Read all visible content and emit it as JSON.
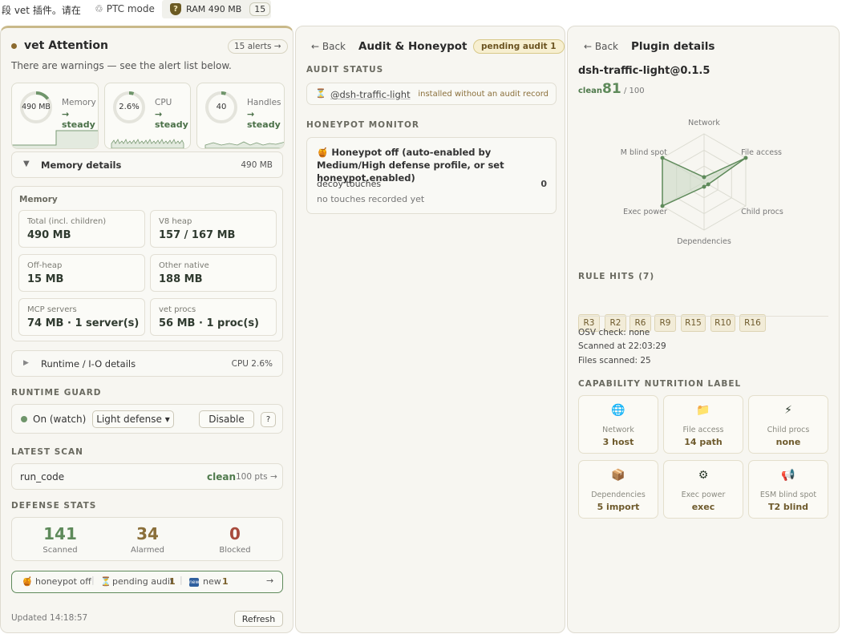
{
  "topbar": {
    "text": "段 vet 插件。请在",
    "ptc_icon": "recycle-icon",
    "ptc_label": "PTC mode",
    "ram_label": "RAM 490 MB",
    "ram_count": "15"
  },
  "left": {
    "title": "vet Attention",
    "alerts_pill": "15 alerts →",
    "warning": "There are warnings — see the alert list below.",
    "gauges": [
      {
        "value": "490 MB",
        "label": "Memory",
        "trend": "→ steady",
        "fraction": 0.15
      },
      {
        "value": "2.6%",
        "label": "CPU",
        "trend": "→ steady",
        "fraction": 0.05
      },
      {
        "value": "40",
        "label": "Handles",
        "trend": "→ steady",
        "fraction": 0.05
      }
    ],
    "memory_details": {
      "label": "Memory details",
      "value": "490 MB",
      "chevron": "▼"
    },
    "memory_section": "Memory",
    "memory_cells": [
      {
        "k": "Total (incl. children)",
        "v": "490 MB"
      },
      {
        "k": "V8 heap",
        "v": "157 / 167 MB"
      },
      {
        "k": "Off-heap",
        "v": "15 MB"
      },
      {
        "k": "Other native",
        "v": "188 MB"
      },
      {
        "k": "MCP servers",
        "v": "74 MB · 1 server(s)"
      },
      {
        "k": "vet procs",
        "v": "56 MB · 1 proc(s)"
      }
    ],
    "runtime_details": {
      "label": "Runtime / I-O details",
      "value": "CPU 2.6%",
      "chevron": "▶"
    },
    "runtime_guard_label": "RUNTIME GUARD",
    "guard_status": "On (watch)",
    "guard_mode": "Light defense ▾",
    "disable_label": "Disable",
    "help_label": "?",
    "latest_scan_label": "LATEST SCAN",
    "scan_name": "run_code",
    "scan_status": "clean",
    "scan_pts": "100 pts →",
    "defense_label": "DEFENSE STATS",
    "stats": [
      {
        "num": "141",
        "label": "Scanned",
        "color": "#5e8a5a"
      },
      {
        "num": "34",
        "label": "Alarmed",
        "color": "#8a6f3a"
      },
      {
        "num": "0",
        "label": "Blocked",
        "color": "#a84b3c"
      }
    ],
    "footer_strip": {
      "honeypot": "honeypot off",
      "pending": "pending audit",
      "pending_n": "1",
      "new": "new",
      "new_n": "1",
      "arrow": "→"
    },
    "updated": "Updated 14:18:57",
    "refresh_label": "Refresh"
  },
  "middle": {
    "back": "← Back",
    "title": "Audit & Honeypot",
    "pending_pill": "pending audit 1",
    "audit_status_label": "AUDIT STATUS",
    "audit_item": "@dsh-traffic-light",
    "audit_note": "installed without an audit record",
    "honeypot_label": "HONEYPOT MONITOR",
    "honeypot_title": "Honeypot off (auto-enabled by Medium/High defense profile, or set honeypot.enabled)",
    "decoy_label": "decoy touches",
    "decoy_value": "0",
    "no_touches": "no touches recorded yet"
  },
  "right": {
    "back": "← Back",
    "title": "Plugin details",
    "plugin_name": "dsh-traffic-light@0.1.5",
    "clean_label": "clean",
    "score": "81",
    "score_max": "/ 100",
    "radar_axes": [
      {
        "label": "Network",
        "value": 0.1
      },
      {
        "label": "File access",
        "value": 1.0
      },
      {
        "label": "Child procs",
        "value": 0.0
      },
      {
        "label": "Dependencies",
        "value": 0.1
      },
      {
        "label": "Exec power",
        "value": 1.0
      },
      {
        "label": "M blind spot",
        "value": 1.0
      }
    ],
    "rule_hits_label": "RULE HITS",
    "rule_hits_count": "(7)",
    "rules": [
      "R3",
      "R2",
      "R6",
      "R9",
      "R15",
      "R10",
      "R16"
    ],
    "osv": "OSV check: none",
    "scanned_at": "Scanned at 22:03:29",
    "files_scanned": "Files scanned: 25",
    "nutrition_label": "CAPABILITY NUTRITION LABEL",
    "caps": [
      {
        "icon": "globe-icon",
        "k": "Network",
        "v": "3 host"
      },
      {
        "icon": "folder-icon",
        "k": "File access",
        "v": "14 path"
      },
      {
        "icon": "lightning-icon",
        "k": "Child procs",
        "v": "none"
      },
      {
        "icon": "package-icon",
        "k": "Dependencies",
        "v": "5 import"
      },
      {
        "icon": "gear-icon",
        "k": "Exec power",
        "v": "exec"
      },
      {
        "icon": "megaphone-icon",
        "k": "ESM blind spot",
        "v": "T2 blind"
      }
    ]
  }
}
